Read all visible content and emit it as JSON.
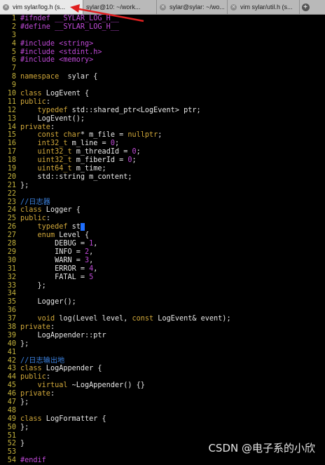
{
  "tabs": [
    {
      "label": "vim sylar/log.h (s...",
      "active": true
    },
    {
      "label": "sylar@10: ~/work...",
      "active": false
    },
    {
      "label": "sylar@sylar: ~/wo...",
      "active": false
    },
    {
      "label": "vim sylar/util.h (s...",
      "active": false
    }
  ],
  "add_tab_icon": "plus-icon",
  "close_icon": "close-icon",
  "annotation_color": "#e02020",
  "cursor_color": "#1f6fff",
  "editor": {
    "lines": [
      {
        "n": "1",
        "segs": [
          [
            "k-pre",
            "#ifndef __SYLAR_LOG_H__"
          ]
        ]
      },
      {
        "n": "2",
        "segs": [
          [
            "k-pre",
            "#define __SYLAR_LOG_H__"
          ]
        ]
      },
      {
        "n": "3",
        "segs": []
      },
      {
        "n": "4",
        "segs": [
          [
            "k-pre",
            "#include "
          ],
          [
            "k-str",
            "<string>"
          ]
        ]
      },
      {
        "n": "5",
        "segs": [
          [
            "k-pre",
            "#include "
          ],
          [
            "k-str",
            "<stdint.h>"
          ]
        ]
      },
      {
        "n": "6",
        "segs": [
          [
            "k-pre",
            "#include "
          ],
          [
            "k-str",
            "<memory>"
          ]
        ]
      },
      {
        "n": "7",
        "segs": []
      },
      {
        "n": "8",
        "segs": [
          [
            "k-kw",
            "namespace"
          ],
          [
            "",
            "  sylar {"
          ]
        ]
      },
      {
        "n": "9",
        "segs": []
      },
      {
        "n": "10",
        "segs": [
          [
            "k-kw",
            "class"
          ],
          [
            "",
            " LogEvent {"
          ]
        ]
      },
      {
        "n": "11",
        "segs": [
          [
            "k-kw",
            "public"
          ],
          [
            "",
            ":"
          ]
        ]
      },
      {
        "n": "12",
        "segs": [
          [
            "",
            "    "
          ],
          [
            "k-kw",
            "typedef"
          ],
          [
            "",
            " std::shared_ptr<LogEvent> ptr;"
          ]
        ]
      },
      {
        "n": "13",
        "segs": [
          [
            "",
            "    LogEvent();"
          ]
        ]
      },
      {
        "n": "14",
        "segs": [
          [
            "k-kw",
            "private"
          ],
          [
            "",
            ":"
          ]
        ]
      },
      {
        "n": "15",
        "segs": [
          [
            "",
            "    "
          ],
          [
            "k-type",
            "const char"
          ],
          [
            "",
            "* m_file = "
          ],
          [
            "k-type",
            "nullptr"
          ],
          [
            "",
            ";"
          ]
        ]
      },
      {
        "n": "16",
        "segs": [
          [
            "",
            "    "
          ],
          [
            "k-type",
            "int32_t"
          ],
          [
            "",
            " m_line = "
          ],
          [
            "k-num",
            "0"
          ],
          [
            "",
            ";"
          ]
        ]
      },
      {
        "n": "17",
        "segs": [
          [
            "",
            "    "
          ],
          [
            "k-type",
            "uint32_t"
          ],
          [
            "",
            " m_threadId = "
          ],
          [
            "k-num",
            "0"
          ],
          [
            "",
            ";"
          ]
        ]
      },
      {
        "n": "18",
        "segs": [
          [
            "",
            "    "
          ],
          [
            "k-type",
            "uint32_t"
          ],
          [
            "",
            " m_fiberId = "
          ],
          [
            "k-num",
            "0"
          ],
          [
            "",
            ";"
          ]
        ]
      },
      {
        "n": "19",
        "segs": [
          [
            "",
            "    "
          ],
          [
            "k-type",
            "uint64_t"
          ],
          [
            "",
            " m_time;"
          ]
        ]
      },
      {
        "n": "20",
        "segs": [
          [
            "",
            "    std::string m_content;"
          ]
        ]
      },
      {
        "n": "21",
        "segs": [
          [
            "",
            "};"
          ]
        ]
      },
      {
        "n": "22",
        "segs": []
      },
      {
        "n": "23",
        "segs": [
          [
            "k-cmt",
            "//日志器"
          ]
        ]
      },
      {
        "n": "24",
        "segs": [
          [
            "k-kw",
            "class"
          ],
          [
            "",
            " Logger {"
          ]
        ]
      },
      {
        "n": "25",
        "segs": [
          [
            "k-kw",
            "public"
          ],
          [
            "",
            ":"
          ]
        ]
      },
      {
        "n": "26",
        "segs": [
          [
            "",
            "    "
          ],
          [
            "k-kw",
            "typedef"
          ],
          [
            "",
            " st"
          ],
          [
            "cursor",
            "_"
          ]
        ]
      },
      {
        "n": "27",
        "segs": [
          [
            "",
            "    "
          ],
          [
            "k-kw",
            "enum"
          ],
          [
            "",
            " Level {"
          ]
        ]
      },
      {
        "n": "28",
        "segs": [
          [
            "",
            "        DEBUG = "
          ],
          [
            "k-num",
            "1"
          ],
          [
            "",
            ","
          ]
        ]
      },
      {
        "n": "29",
        "segs": [
          [
            "",
            "        INFO = "
          ],
          [
            "k-num",
            "2"
          ],
          [
            "",
            ","
          ]
        ]
      },
      {
        "n": "30",
        "segs": [
          [
            "",
            "        WARN = "
          ],
          [
            "k-num",
            "3"
          ],
          [
            "",
            ","
          ]
        ]
      },
      {
        "n": "31",
        "segs": [
          [
            "",
            "        ERROR = "
          ],
          [
            "k-num",
            "4"
          ],
          [
            "",
            ","
          ]
        ]
      },
      {
        "n": "32",
        "segs": [
          [
            "",
            "        FATAL = "
          ],
          [
            "k-num",
            "5"
          ]
        ]
      },
      {
        "n": "33",
        "segs": [
          [
            "",
            "    };"
          ]
        ]
      },
      {
        "n": "34",
        "segs": []
      },
      {
        "n": "35",
        "segs": [
          [
            "",
            "    Logger();"
          ]
        ]
      },
      {
        "n": "36",
        "segs": []
      },
      {
        "n": "37",
        "segs": [
          [
            "",
            "    "
          ],
          [
            "k-type",
            "void"
          ],
          [
            "",
            " log(Level level, "
          ],
          [
            "k-type",
            "const"
          ],
          [
            "",
            " LogEvent& event);"
          ]
        ]
      },
      {
        "n": "38",
        "segs": [
          [
            "k-kw",
            "private"
          ],
          [
            "",
            ":"
          ]
        ]
      },
      {
        "n": "39",
        "segs": [
          [
            "",
            "    LogAppender::ptr"
          ]
        ]
      },
      {
        "n": "40",
        "segs": [
          [
            "",
            "};"
          ]
        ]
      },
      {
        "n": "41",
        "segs": []
      },
      {
        "n": "42",
        "segs": [
          [
            "k-cmt",
            "//日志输出地"
          ]
        ]
      },
      {
        "n": "43",
        "segs": [
          [
            "k-kw",
            "class"
          ],
          [
            "",
            " LogAppender {"
          ]
        ]
      },
      {
        "n": "44",
        "segs": [
          [
            "k-kw",
            "public"
          ],
          [
            "",
            ":"
          ]
        ]
      },
      {
        "n": "45",
        "segs": [
          [
            "",
            "    "
          ],
          [
            "k-kw",
            "virtual"
          ],
          [
            "",
            " ~LogAppender() {}"
          ]
        ]
      },
      {
        "n": "46",
        "segs": [
          [
            "k-kw",
            "private"
          ],
          [
            "",
            ":"
          ]
        ]
      },
      {
        "n": "47",
        "segs": [
          [
            "",
            "};"
          ]
        ]
      },
      {
        "n": "48",
        "segs": []
      },
      {
        "n": "49",
        "segs": [
          [
            "k-kw",
            "class"
          ],
          [
            "",
            " LogFormatter {"
          ]
        ]
      },
      {
        "n": "50",
        "segs": [
          [
            "",
            "};"
          ]
        ]
      },
      {
        "n": "51",
        "segs": []
      },
      {
        "n": "52",
        "segs": [
          [
            "",
            "}"
          ]
        ]
      },
      {
        "n": "53",
        "segs": []
      },
      {
        "n": "54",
        "segs": [
          [
            "k-pre",
            "#endif"
          ]
        ]
      }
    ]
  },
  "watermark": "CSDN @电子系的小欣"
}
